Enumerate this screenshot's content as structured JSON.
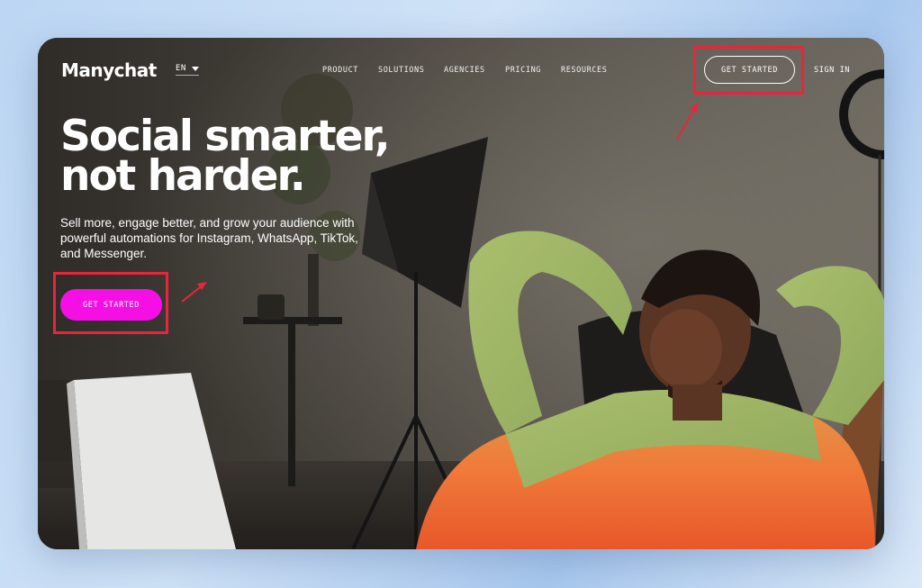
{
  "nav": {
    "logo": "Manychat",
    "language": "EN",
    "links": [
      "PRODUCT",
      "SOLUTIONS",
      "AGENCIES",
      "PRICING",
      "RESOURCES"
    ],
    "get_started": "GET STARTED",
    "sign_in": "SIGN IN"
  },
  "hero": {
    "title_line1": "Social smarter,",
    "title_line2": "not harder.",
    "subtitle": "Sell more, engage better, and grow your audience with powerful automations for Instagram, WhatsApp, TikTok, and Messenger.",
    "cta": "GET STARTED"
  },
  "colors": {
    "cta_background": "#f50fe4",
    "highlight": "#e8263b",
    "page_background": "#c7dcf4"
  },
  "icons": [
    "chevron-down-icon",
    "arrow-annotation-icon"
  ]
}
